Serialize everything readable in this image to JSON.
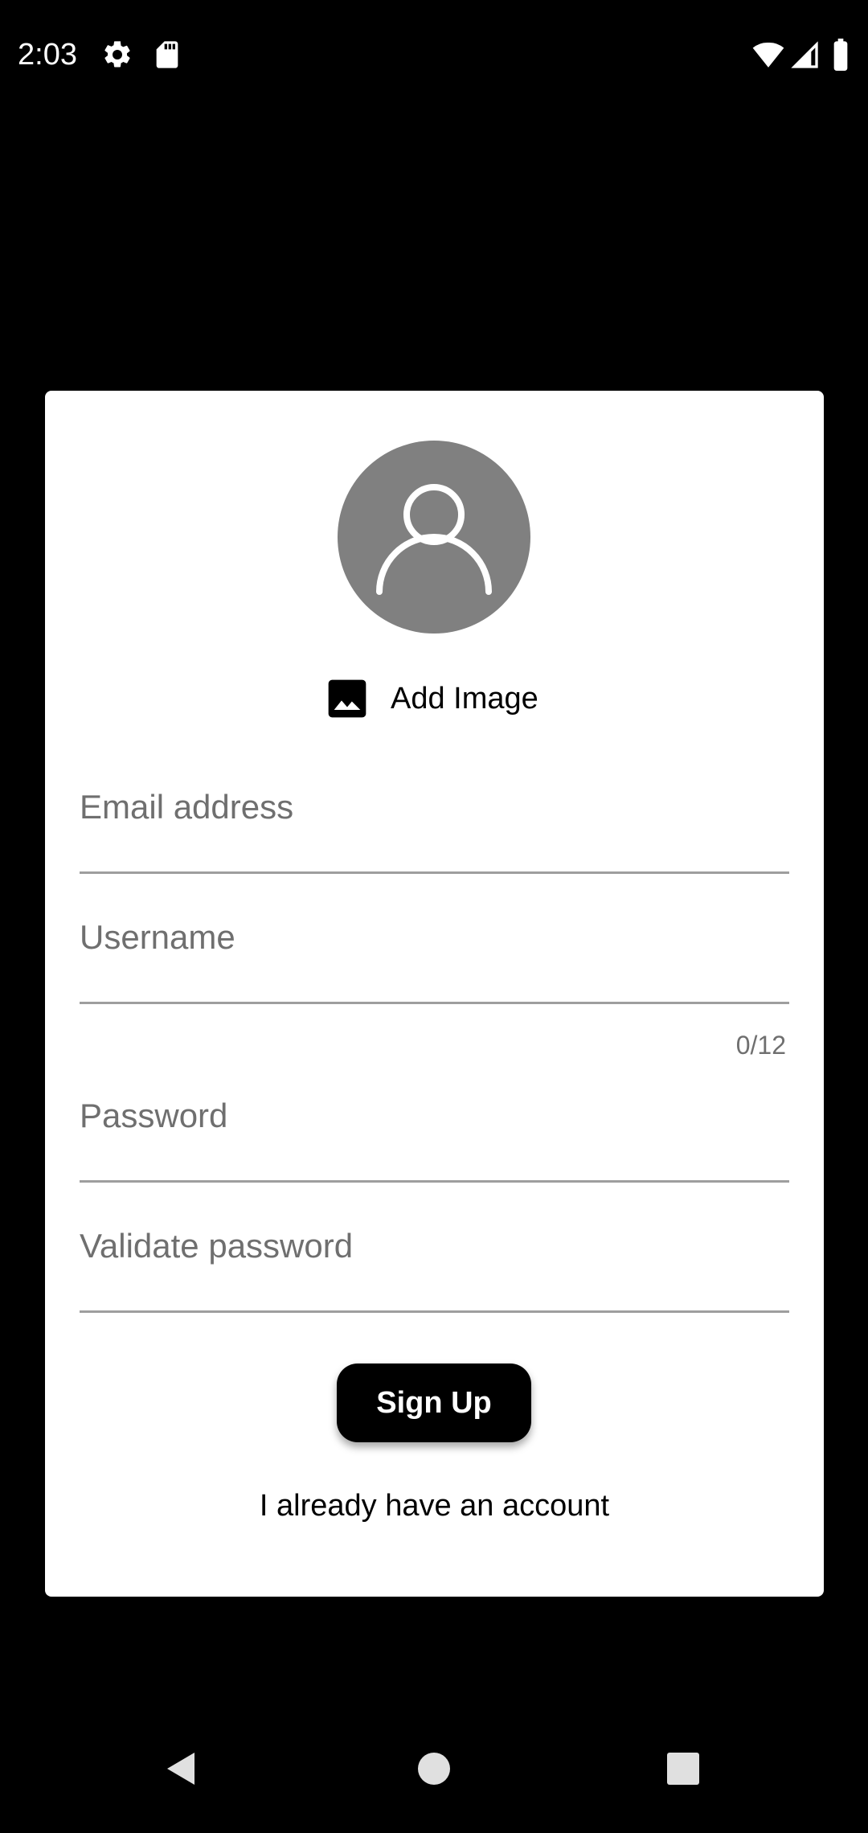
{
  "status_bar": {
    "time": "2:03",
    "icons": [
      "settings-icon",
      "sd-card-icon",
      "wifi-icon",
      "signal-icon",
      "battery-icon"
    ]
  },
  "signup_card": {
    "avatar_icon": "person-icon",
    "add_image_label": "Add Image",
    "fields": {
      "email": {
        "placeholder": "Email address",
        "value": ""
      },
      "username": {
        "placeholder": "Username",
        "value": "",
        "counter": "0/12"
      },
      "password": {
        "placeholder": "Password",
        "value": ""
      },
      "validate_password": {
        "placeholder": "Validate password",
        "value": ""
      }
    },
    "signup_button_label": "Sign Up",
    "account_link_label": "I already have an account"
  },
  "nav_bar": {
    "buttons": [
      "back-icon",
      "home-icon",
      "recents-icon"
    ]
  },
  "colors": {
    "background": "#000000",
    "card": "#ffffff",
    "avatar": "#808080",
    "placeholder": "#6f6f6f",
    "underline": "#9e9e9e"
  }
}
